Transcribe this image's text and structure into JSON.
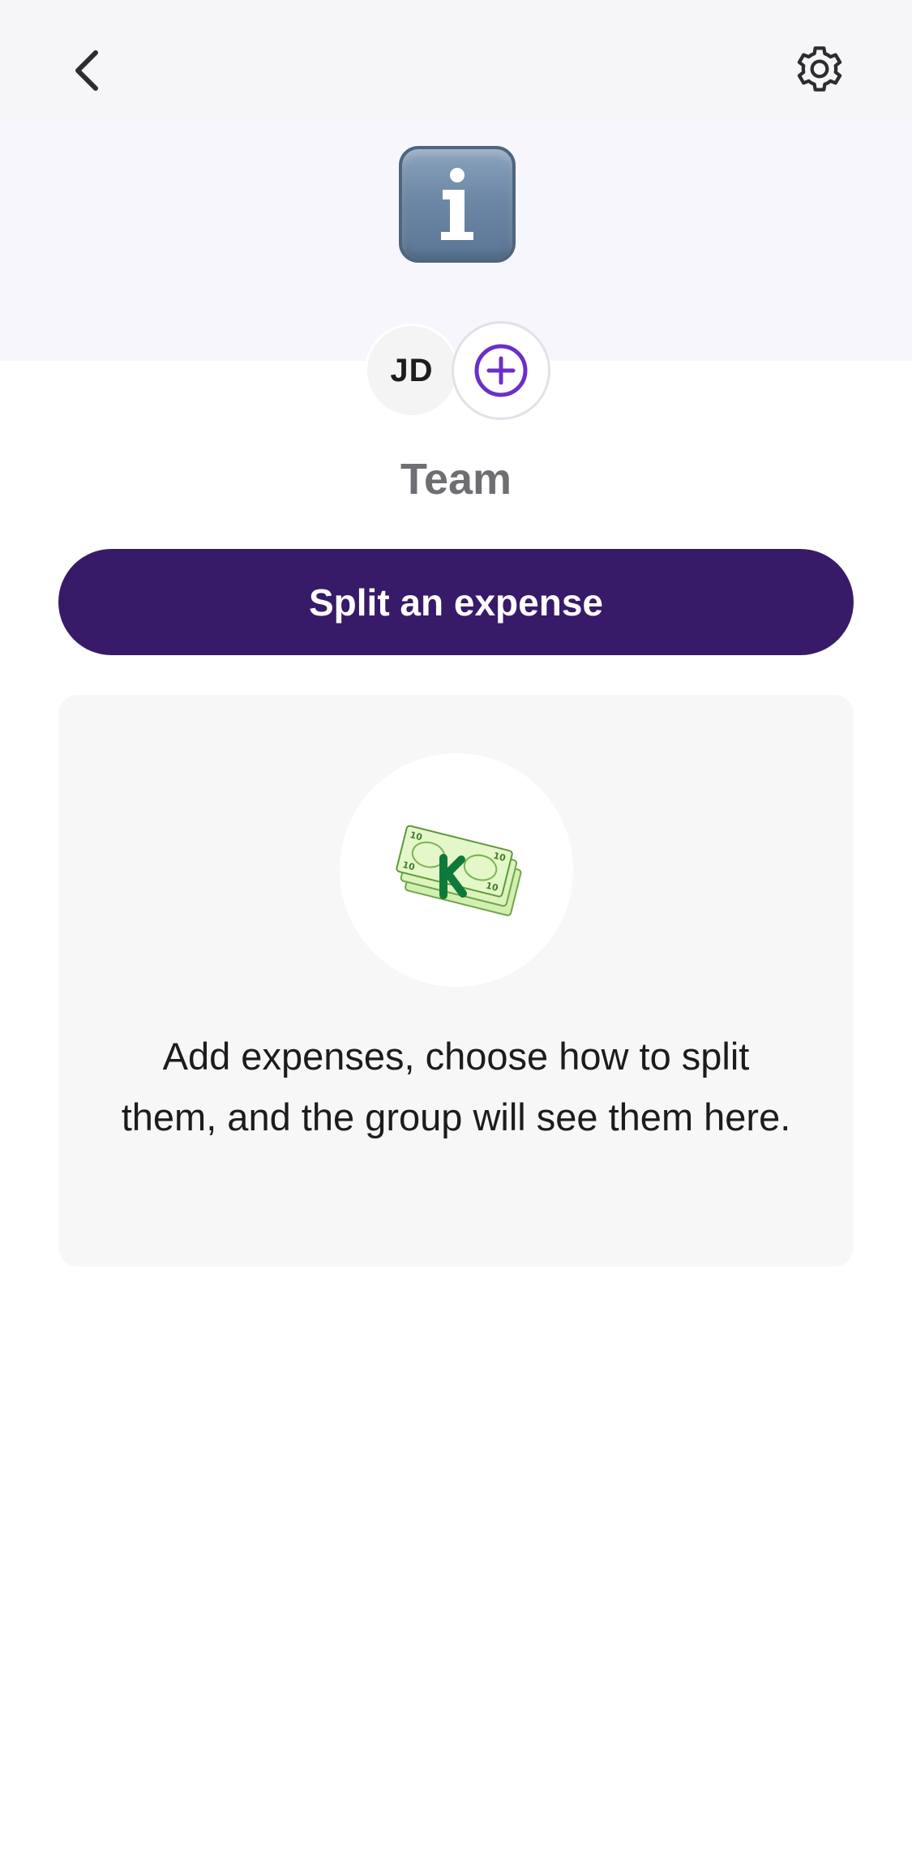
{
  "nav": {
    "back_icon": "chevron-left-icon",
    "settings_icon": "gear-icon"
  },
  "group": {
    "emoji_icon": "information-emoji-icon",
    "name": "Team",
    "members": [
      {
        "initials": "JD"
      }
    ],
    "add_member_icon": "plus-circle-icon"
  },
  "actions": {
    "split_label": "Split an expense"
  },
  "empty_state": {
    "illustration": "money-bills-icon",
    "message": "Add expenses, choose how to split them, and the group will see them here."
  },
  "colors": {
    "accent": "#371b69",
    "add_icon": "#6b2fc8",
    "header_band": "#f8f6fd"
  }
}
